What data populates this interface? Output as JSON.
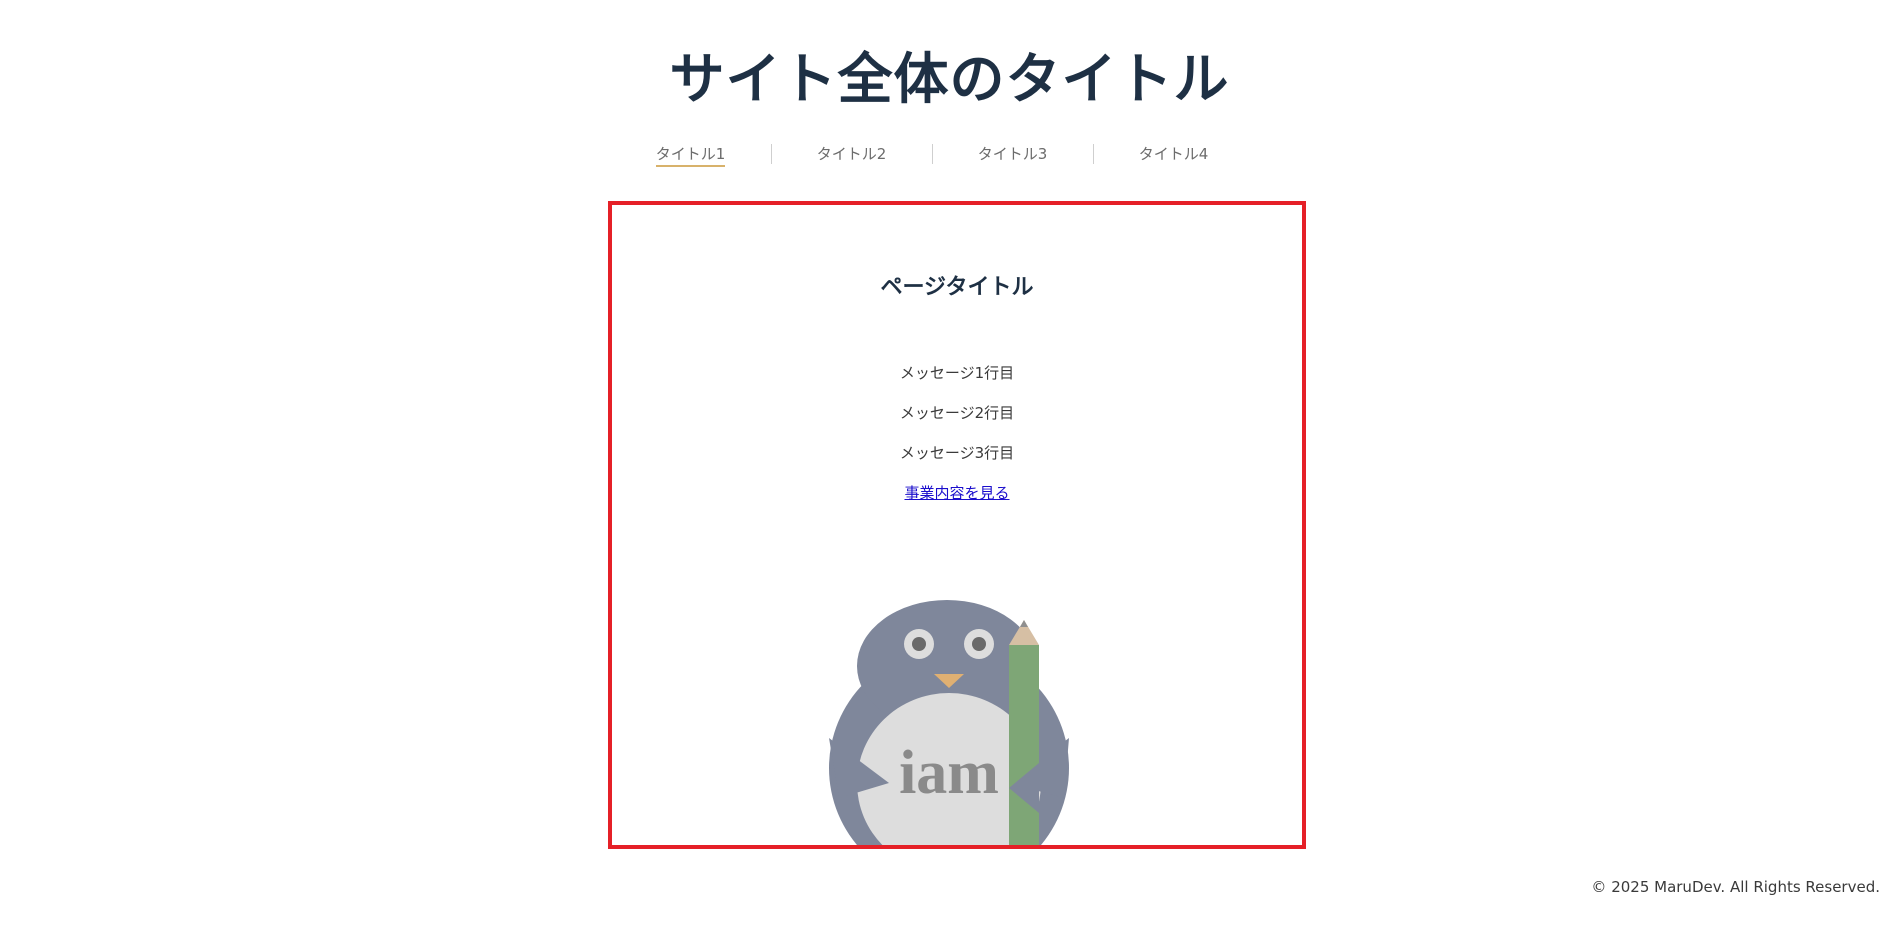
{
  "header": {
    "site_title": "サイト全体のタイトル"
  },
  "nav": {
    "items": [
      {
        "label": "タイトル1",
        "active": true
      },
      {
        "label": "タイトル2",
        "active": false
      },
      {
        "label": "タイトル3",
        "active": false
      },
      {
        "label": "タイトル4",
        "active": false
      }
    ],
    "active_underline_color": "#d8b26b"
  },
  "main": {
    "page_title": "ページタイトル",
    "messages": [
      "メッセージ1行目",
      "メッセージ2行目",
      "メッセージ3行目"
    ],
    "link_label": "事業内容を見る",
    "border_color": "#e52027",
    "mascot": {
      "icon": "penguin-mascot-icon",
      "text": "iam"
    }
  },
  "footer": {
    "copyright": "© 2025 MaruDev. All Rights Reserved."
  }
}
